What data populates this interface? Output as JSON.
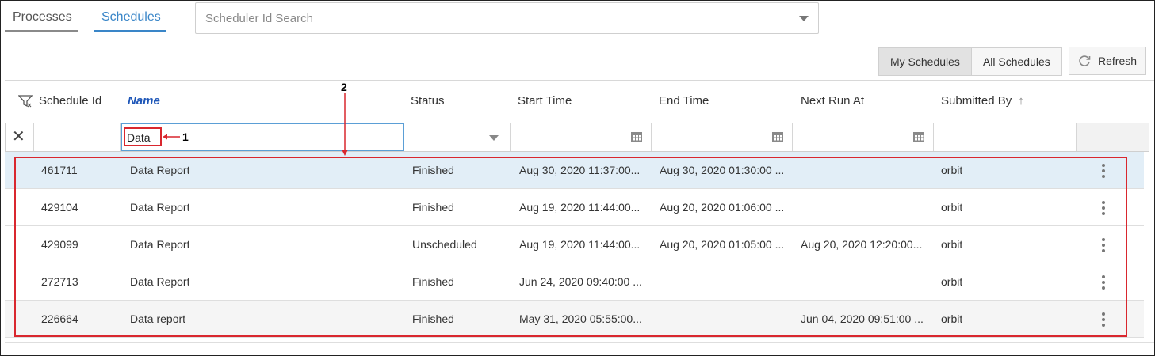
{
  "tabs": [
    {
      "label": "Processes"
    },
    {
      "label": "Schedules",
      "active": true
    }
  ],
  "search": {
    "placeholder": "Scheduler Id Search",
    "value": ""
  },
  "toolbar": {
    "my_schedules": "My Schedules",
    "all_schedules": "All Schedules",
    "refresh": "Refresh"
  },
  "columns": {
    "schedule_id": "Schedule Id",
    "name": "Name",
    "status": "Status",
    "start_time": "Start Time",
    "end_time": "End Time",
    "next_run_at": "Next Run At",
    "submitted_by": "Submitted By"
  },
  "filters": {
    "name": "Data"
  },
  "rows": [
    {
      "id": "461711",
      "name": "Data Report",
      "status": "Finished",
      "start": "Aug 30, 2020 11:37:00...",
      "end": "Aug 30, 2020 01:30:00 ...",
      "next": "",
      "by": "orbit"
    },
    {
      "id": "429104",
      "name": "Data Report",
      "status": "Finished",
      "start": "Aug 19, 2020 11:44:00...",
      "end": "Aug 20, 2020 01:06:00 ...",
      "next": "",
      "by": "orbit"
    },
    {
      "id": "429099",
      "name": "Data Report",
      "status": "Unscheduled",
      "start": "Aug 19, 2020 11:44:00...",
      "end": "Aug 20, 2020 01:05:00 ...",
      "next": "Aug 20, 2020 12:20:00...",
      "by": "orbit"
    },
    {
      "id": "272713",
      "name": "Data Report",
      "status": "Finished",
      "start": "Jun 24, 2020 09:40:00 ...",
      "end": "",
      "next": "",
      "by": "orbit"
    },
    {
      "id": "226664",
      "name": "Data report",
      "status": "Finished",
      "start": "May 31, 2020 05:55:00...",
      "end": "",
      "next": "Jun 04, 2020 09:51:00 ...",
      "by": "orbit"
    }
  ],
  "annotations": {
    "label1": "1",
    "label2": "2"
  },
  "colors": {
    "accent": "#3a86c8",
    "annotation": "#d9272e",
    "selected_row": "#e2eef7"
  }
}
